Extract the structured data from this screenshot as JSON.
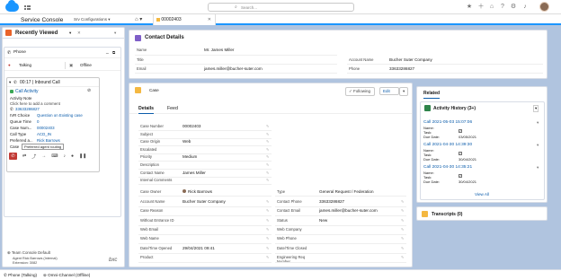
{
  "app": {
    "name": "Service Console",
    "nav_menu": "Srv Configurations"
  },
  "search": {
    "scope": "All",
    "placeholder": "Search..."
  },
  "header_icons": [
    "star-icon",
    "add-icon",
    "trailhead-icon",
    "help-icon",
    "setup-icon",
    "bell-icon"
  ],
  "tabs": [
    {
      "label": "00002403"
    }
  ],
  "sidebar": {
    "title": "Recently Viewed",
    "phone_label": "Phone",
    "talking_label": "Talking",
    "offline_label": "Offline",
    "call_timer": "00:17 | Inbound Call",
    "call_activity": "Call Activity",
    "activity_note_label": "Activity Note",
    "activity_note_placeholder": "Click here to add a comment",
    "phone_number": "33633286827",
    "details": [
      {
        "label": "IVR Choice",
        "value": "Question on Existing case"
      },
      {
        "label": "Queue Time",
        "value": "0"
      },
      {
        "label": "Case Num...",
        "value": "00002403"
      },
      {
        "label": "Call Type",
        "value": "ACD_IN"
      },
      {
        "label": "Preferred a...",
        "value": "Rick Barrows"
      },
      {
        "label": "Case",
        "value": ""
      }
    ],
    "tooltip": "Preferred agent routing",
    "team_label": "Team Console Default",
    "agent_line1": "Agent Rick Barrows (Internal)",
    "agent_line2": "Extension: 3082",
    "logo": "bxc"
  },
  "contact": {
    "header": "Contact Details",
    "fields": [
      {
        "label": "Name",
        "value": "Mr. James Miller",
        "link": false
      },
      {
        "label": "Account Name",
        "value": "Bucher Suter Company",
        "link": true
      },
      {
        "label": "Title",
        "value": "",
        "link": false
      },
      {
        "label": "Phone",
        "value": "33633286827",
        "link": true
      },
      {
        "label": "Email",
        "value": "james.miller@bucher-suter.com",
        "link": true
      }
    ]
  },
  "case": {
    "header": "Case",
    "following": "Following",
    "edit": "Edit",
    "tabs": [
      "Details",
      "Feed"
    ],
    "left_fields": [
      {
        "label": "Case Number",
        "value": "00002403",
        "link": false
      },
      {
        "label": "Subject",
        "value": "",
        "link": false
      },
      {
        "label": "Case Origin",
        "value": "Web",
        "link": false
      },
      {
        "label": "Escalated",
        "value": "",
        "link": false
      },
      {
        "label": "Priority",
        "value": "Medium",
        "link": false
      },
      {
        "label": "Description",
        "value": "",
        "link": false
      },
      {
        "label": "Contact Name",
        "value": "James Miller",
        "link": true
      },
      {
        "label": "Internal Comments",
        "value": "",
        "link": false
      }
    ],
    "owner": {
      "label": "Case Owner",
      "value": "Rick Barrows"
    },
    "type": {
      "label": "Type",
      "value": "General Request / Federation"
    },
    "pairs": [
      {
        "l_label": "Account Name",
        "l_value": "Bucher Suter Company",
        "l_link": true,
        "r_label": "Contact Phone",
        "r_value": "33633286827",
        "r_link": true
      },
      {
        "l_label": "Case Reason",
        "l_value": "",
        "l_link": false,
        "r_label": "Contact Email",
        "r_value": "james.miller@bucher-suter.com",
        "r_link": true
      },
      {
        "l_label": "Without Entrance ID",
        "l_value": "",
        "l_link": false,
        "r_label": "Status",
        "r_value": "New",
        "r_link": false
      },
      {
        "l_label": "Web Email",
        "l_value": "",
        "l_link": false,
        "r_label": "Web Company",
        "r_value": "",
        "r_link": false
      },
      {
        "l_label": "Web Name",
        "l_value": "",
        "l_link": false,
        "r_label": "Web Phone",
        "r_value": "",
        "r_link": false
      },
      {
        "l_label": "Date/Time Opened",
        "l_value": "29/04/2021 09:41",
        "l_link": false,
        "r_label": "Date/Time Closed",
        "r_value": "",
        "r_link": false
      },
      {
        "l_label": "Product",
        "l_value": "",
        "l_link": false,
        "r_label": "Engineering Req Number",
        "r_value": "",
        "r_link": false
      }
    ]
  },
  "related": {
    "header": "Related",
    "activity_title": "Activity History (3+)",
    "calls": [
      {
        "title": "Call 2021-05-03 15:07:06",
        "name_label": "Name:",
        "task_label": "Task:",
        "due_label": "Due Date:",
        "due": "03/05/2021"
      },
      {
        "title": "Call 2021-04-30 14:39:30",
        "name_label": "Name:",
        "task_label": "Task:",
        "due_label": "Due Date:",
        "due": "30/04/2021"
      },
      {
        "title": "Call 2021-04-30 14:35:21",
        "name_label": "Name:",
        "task_label": "Task:",
        "due_label": "Due Date:",
        "due": "30/04/2021"
      }
    ],
    "view_all": "View All",
    "transcripts": "Transcripts (0)"
  },
  "statusbar": {
    "phone": "Phone (Talking)",
    "omni": "Omni-Channel (Offline)"
  },
  "colors": {
    "brand": "#1b96ff",
    "link": "#0b5cab",
    "task_icon": "#3ba755",
    "activity_icon": "#2e844a",
    "case_icon": "#f4b841",
    "contact_icon": "#7f5fc8",
    "transcript_icon": "#f4b841",
    "end_call": "#c23934"
  }
}
